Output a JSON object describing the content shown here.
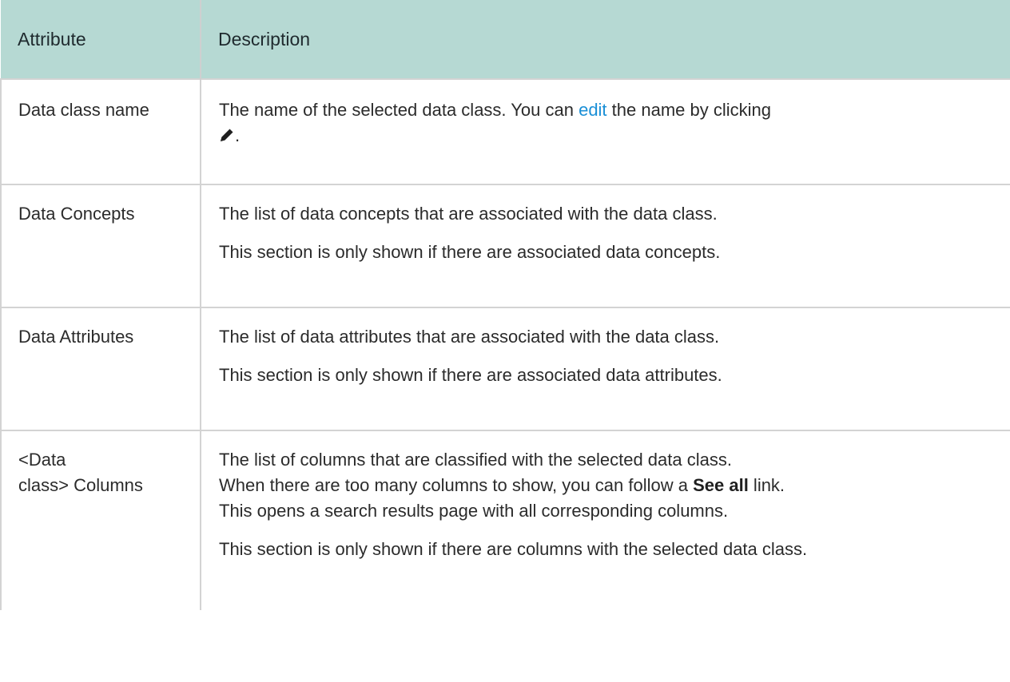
{
  "table": {
    "headers": [
      "Attribute",
      "Description"
    ],
    "rows": [
      {
        "attribute": "Data class name",
        "desc_before_link": "The name of the selected data class. You can ",
        "link": "edit",
        "desc_after_link": " the name by clicking",
        "desc_end": "."
      },
      {
        "attribute": "Data Concepts",
        "p1": "The list of data concepts that are associated with the data class.",
        "p2": "This section is only shown if there are associated data concepts."
      },
      {
        "attribute": "Data Attributes",
        "p1": "The list of data attributes that are associated with the data class.",
        "p2": "This section is only shown if there are associated data attributes."
      },
      {
        "attribute_line1": "<Data",
        "attribute_line2": "class> Columns",
        "p1_part1": "The list of columns that are classified with the selected data class.",
        "p1_part2": "When there are too many columns to show, you can follow a ",
        "p1_bold": "See all",
        "p1_part3": " link.",
        "p1_part4": "This opens a search results page with all corresponding columns.",
        "p2": "This section is only shown if there are columns with the selected data class."
      }
    ]
  },
  "icons": {
    "edit": "pencil-icon"
  },
  "colors": {
    "header_bg": "#b6d9d3",
    "link": "#1a8fd6"
  }
}
